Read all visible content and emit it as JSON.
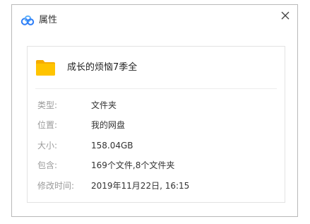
{
  "dialog": {
    "title": "属性",
    "app_icon": "baidu-netdisk-cloud-icon",
    "close_symbol": "✕",
    "brand_colors": {
      "cloud_blue": "#2e7ef7",
      "cloud_light": "#5fb0fb",
      "folder_yellow": "#ffc400",
      "folder_tab": "#f5ac00"
    }
  },
  "file": {
    "icon": "folder-icon",
    "name": "成长的烦恼7季全"
  },
  "properties": [
    {
      "label": "类型:",
      "value": "文件夹"
    },
    {
      "label": "位置:",
      "value": "我的网盘"
    },
    {
      "label": "大小:",
      "value": "158.04GB"
    },
    {
      "label": "包含:",
      "value": "169个文件,8个文件夹"
    },
    {
      "label": "修改时间:",
      "value": "2019年11月22日, 16:15"
    }
  ]
}
